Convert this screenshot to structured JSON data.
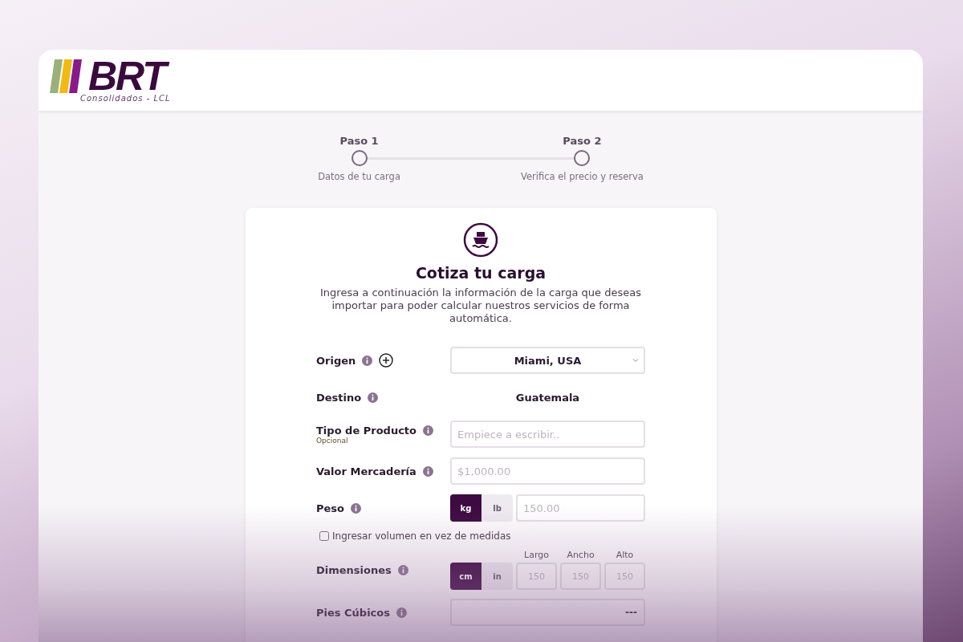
{
  "header": {
    "logo_text": "BRT",
    "logo_tagline": "Consolidados - LCL"
  },
  "steps": [
    {
      "title": "Paso 1",
      "caption": "Datos de tu carga",
      "selected": false
    },
    {
      "title": "Paso 2",
      "caption": "Verifica el precio y reserva",
      "selected": false
    }
  ],
  "form": {
    "title": "Cotiza tu carga",
    "description": "Ingresa a continuación la información de la carga que deseas importar para poder calcular nuestros servicios de forma automática.",
    "fields": [
      {
        "kind": "select",
        "label": "Origen",
        "add_button": true,
        "value": "Miami, USA"
      },
      {
        "kind": "readonly",
        "label": "Destino",
        "value": "Guatemala"
      },
      {
        "kind": "text",
        "label": "Tipo de Producto",
        "sublabel": "Opcional",
        "placeholder": "Empiece a escribir.."
      },
      {
        "kind": "text",
        "label": "Valor Mercadería",
        "placeholder": "$1,000.00"
      },
      {
        "kind": "unit",
        "label": "Peso",
        "units": [
          {
            "label": "kg",
            "selected": true
          },
          {
            "label": "lb",
            "selected": false
          }
        ],
        "placeholder": "150.00"
      },
      {
        "kind": "checkbox",
        "label": "Ingresar volumen en vez de medidas",
        "checked": false
      },
      {
        "kind": "dimensions",
        "label": "Dimensiones",
        "units": [
          {
            "label": "cm",
            "selected": true
          },
          {
            "label": "in",
            "selected": false
          }
        ],
        "dims": [
          {
            "label": "Largo",
            "placeholder": "150"
          },
          {
            "label": "Ancho",
            "placeholder": "150"
          },
          {
            "label": "Alto",
            "placeholder": "150"
          }
        ]
      },
      {
        "kind": "readonly_box",
        "label": "Pies Cúbicos",
        "value": "---"
      }
    ]
  }
}
